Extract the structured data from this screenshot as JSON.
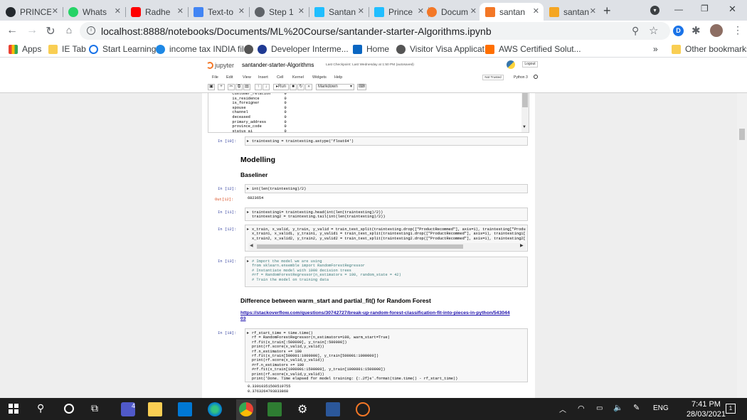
{
  "browser": {
    "tabs": [
      {
        "label": "PRINCE",
        "color": "#24292e"
      },
      {
        "label": "Whats",
        "color": "#25d366"
      },
      {
        "label": "Radhe",
        "color": "#ff0000"
      },
      {
        "label": "Text-to",
        "color": "#4285f4"
      },
      {
        "label": "Step 1",
        "color": "#5f6368"
      },
      {
        "label": "Santan",
        "color": "#20beff"
      },
      {
        "label": "Prince",
        "color": "#20beff"
      },
      {
        "label": "Docum",
        "color": "#f37726"
      },
      {
        "label": "santan",
        "color": "#f37726"
      },
      {
        "label": "santan",
        "color": "#f5a623"
      }
    ],
    "url": "localhost:8888/notebooks/Documents/ML%20Course/santander-starter-Algorithms.ipynb",
    "profile_badge": "D",
    "bookmarks": [
      {
        "label": "Apps"
      },
      {
        "label": "IE Tab"
      },
      {
        "label": "Start Learning"
      },
      {
        "label": "income tax INDIA file"
      },
      {
        "label": "Developer Interme..."
      },
      {
        "label": "Home"
      },
      {
        "label": "Visitor Visa Applicat..."
      },
      {
        "label": "AWS Certified Solut..."
      },
      {
        "label": "»"
      },
      {
        "label": "Other bookmarks"
      }
    ]
  },
  "jupyter": {
    "logo": "jupyter",
    "notebook_name": "santander-starter-Algorithms",
    "checkpoint": "Last Checkpoint: Last Wednesday at 1:50 PM  (autosaved)",
    "logout": "Logout",
    "menu": [
      "File",
      "Edit",
      "View",
      "Insert",
      "Cell",
      "Kernel",
      "Widgets",
      "Help"
    ],
    "trust": "Not Trusted",
    "kernel": "Python 3",
    "toolbar": {
      "run_label": "Run",
      "cell_type": "Markdown"
    }
  },
  "cells": {
    "scroll_output": "        customer_relation      0\n        is_residence           0\n        is_foreigner           0\n        spouse                 0\n        channel                0\n        deceased               0\n        primary_address        0\n        province_code          0\n        status_ai              0",
    "c10": {
      "prompt": "In [10]:",
      "code": "traintesting = traintesting.astype('float64')"
    },
    "h_modelling": "Modelling",
    "h_baseliner": "Baseliner",
    "c12": {
      "prompt": "In [12]:",
      "code": "int(len(traintesting)/2)",
      "out_prompt": "Out[12]:",
      "output": "6823654"
    },
    "c11": {
      "prompt": "In [11]:",
      "code": "traintesting1= traintesting.head(int(len(traintesting)/2))\ntraintesting2 = traintesting.tail(int(len(traintesting)/2))"
    },
    "c12b": {
      "prompt": "In [12]:",
      "code": "x_train, x_valid, y_train, y_valid = train_test_split(traintesting.drop([\"ProductRecommed\"], axis=1), traintesting[\"ProductR\nx_train1, x_valid1, y_train1, y_valid1 = train_test_split(traintesting1.drop([\"ProductRecommed\"], axis=1), traintesting1[\"Pr\nx_train2, x_valid2, y_train2, y_valid2 = train_test_split(traintesting2.drop([\"ProductRecommed\"], axis=1), traintesting2[\"Pr"
    },
    "c13": {
      "prompt": "In [13]:",
      "code": "# Import the model we are using\nfrom sklearn.ensemble import RandomForestRegressor\n# Instantiate model with 1000 decision trees\n#rf = RandomForestRegressor(n_estimators = 100, random_state = 42)\n# Train the model on training data"
    },
    "h_difference": "Difference between warm_start and partial_fit() for Random Forest",
    "link": "https://stackoverflow.com/questions/30742727/break-up-random-forest-classification-fit-into-pieces-in-python/54304403",
    "c18": {
      "prompt": "In [18]:",
      "code": "rf_start_time = time.time()\nrf = RandomForestRegressor(n_estimators=100, warm_start=True)\nrf.fit(x_train[:500000], y_train[:500000])\nprint(rf.score(x_valid,y_valid))\nrf.n_estimators += 100\nrf.fit(x_train[500001:1000000], y_train[500001:1000000])\nprint(rf.score(x_valid,y_valid))\n#rf.n_estimators += 100\n#rf.fit(x_train[1000001:1500000], y_train[1000001:1500000])\nprint(rf.score(x_valid,y_valid))\nprint('Done. Time elapsed for model training: {:.2f}s'.format(time.time() - rf_start_time))",
      "output": "0.33910351560519755\n0.3763264793833868"
    }
  },
  "taskbar": {
    "time": "7:41 PM",
    "date": "28/03/2021",
    "lang": "ENG",
    "notif_count": "1",
    "teams_badge": "4"
  }
}
